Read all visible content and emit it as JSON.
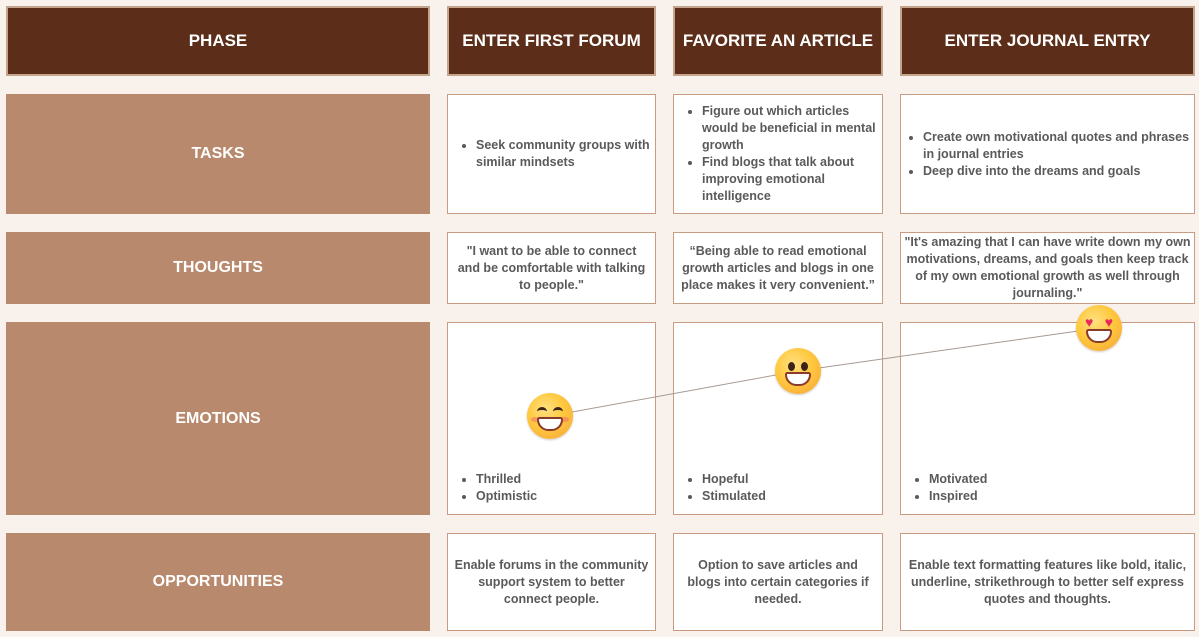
{
  "headers": {
    "phase": "PHASE",
    "col1": "ENTER FIRST FORUM",
    "col2": "FAVORITE AN ARTICLE",
    "col3": "ENTER JOURNAL ENTRY"
  },
  "rows": {
    "tasks": "TASKS",
    "thoughts": "THOUGHTS",
    "emotions": "EMOTIONS",
    "opportunities": "OPPORTUNITIES"
  },
  "tasks": {
    "col1": [
      "Seek community groups with similar mindsets"
    ],
    "col2": [
      "Figure out which articles would be beneficial in mental growth",
      "Find blogs that talk about improving emotional intelligence"
    ],
    "col3": [
      "Create own motivational quotes and phrases in journal entries",
      "Deep dive into the dreams and goals"
    ]
  },
  "thoughts": {
    "col1": "\"I want to be able to connect and be comfortable with talking to people.\"",
    "col2": "“Being able to read emotional growth articles and blogs in one place makes it very convenient.”",
    "col3": "\"It's amazing that I can have write down my own motivations, dreams, and goals then keep track of my own emotional growth as well through journaling.\""
  },
  "emotions": {
    "col1": [
      "Thrilled",
      "Optimistic"
    ],
    "col2": [
      "Hopeful",
      "Stimulated"
    ],
    "col3": [
      "Motivated",
      "Inspired"
    ],
    "icons": [
      "grinning-squinting-face-icon",
      "grinning-face-big-eyes-icon",
      "heart-eyes-face-icon"
    ]
  },
  "opportunities": {
    "col1": "Enable forums in the community support system to better connect people.",
    "col2": "Option to save articles and blogs into certain categories if needed.",
    "col3": "Enable text formatting features like bold, italic, underline, strikethrough to better self express quotes and thoughts."
  },
  "colors": {
    "header_bg": "#5c2e1a",
    "row_label_bg": "#b8896c",
    "page_bg": "#f8f1ec",
    "box_border": "#c89c80"
  }
}
